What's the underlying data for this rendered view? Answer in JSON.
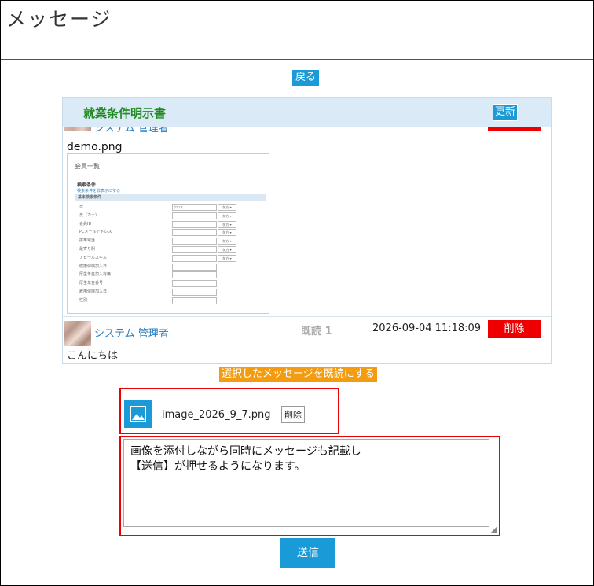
{
  "page": {
    "title": "メッセージ"
  },
  "nav": {
    "back_label": "戻る"
  },
  "thread": {
    "title": "就業条件明示書",
    "refresh_label": "更新",
    "prev_message": {
      "sender_partial": "システム 管理者",
      "attachment_name": "demo.png",
      "thumbnail": {
        "title": "会員一覧",
        "section": "検索条件",
        "link": "検索条件を非表示にする",
        "band": "基本検索条件",
        "rows": [
          {
            "label": "氏",
            "value": "クロス",
            "mode": "前方"
          },
          {
            "label": "氏（カナ）",
            "value": "",
            "mode": "前方"
          },
          {
            "label": "会員ID",
            "value": "",
            "mode": "前方"
          },
          {
            "label": "PCメールアドレス",
            "value": "",
            "mode": "前方"
          },
          {
            "label": "携帯電話",
            "value": "",
            "mode": "前方"
          },
          {
            "label": "最寄り駅",
            "value": "",
            "mode": "前方"
          },
          {
            "label": "アピールスキル",
            "value": "",
            "mode": "前方"
          },
          {
            "label": "健康保険加入日",
            "value": "",
            "mode": ""
          },
          {
            "label": "厚生年金加入有無",
            "value": "",
            "mode": ""
          },
          {
            "label": "厚生年金番号",
            "value": "",
            "mode": ""
          },
          {
            "label": "雇用保険加入日",
            "value": "",
            "mode": ""
          },
          {
            "label": "性別",
            "value": "",
            "mode": ""
          }
        ]
      }
    },
    "message": {
      "sender": "システム 管理者",
      "read_status": "既読 1",
      "timestamp": "2026-09-04 11:18:09",
      "delete_label": "削除",
      "body": "こんにちは"
    },
    "mark_read_label": "選択したメッセージを既読にする"
  },
  "composer": {
    "attachment": {
      "filename": "image_2026_9_7.png",
      "remove_label": "削除",
      "icon": "image-icon"
    },
    "text": "画像を添付しながら同時にメッセージも記載し\n【送信】が押せるようになります。",
    "send_label": "送信"
  },
  "colors": {
    "accent": "#1a9ad6",
    "danger": "#ee0000",
    "warning": "#f39c12",
    "title_green": "#1f8a1f"
  }
}
